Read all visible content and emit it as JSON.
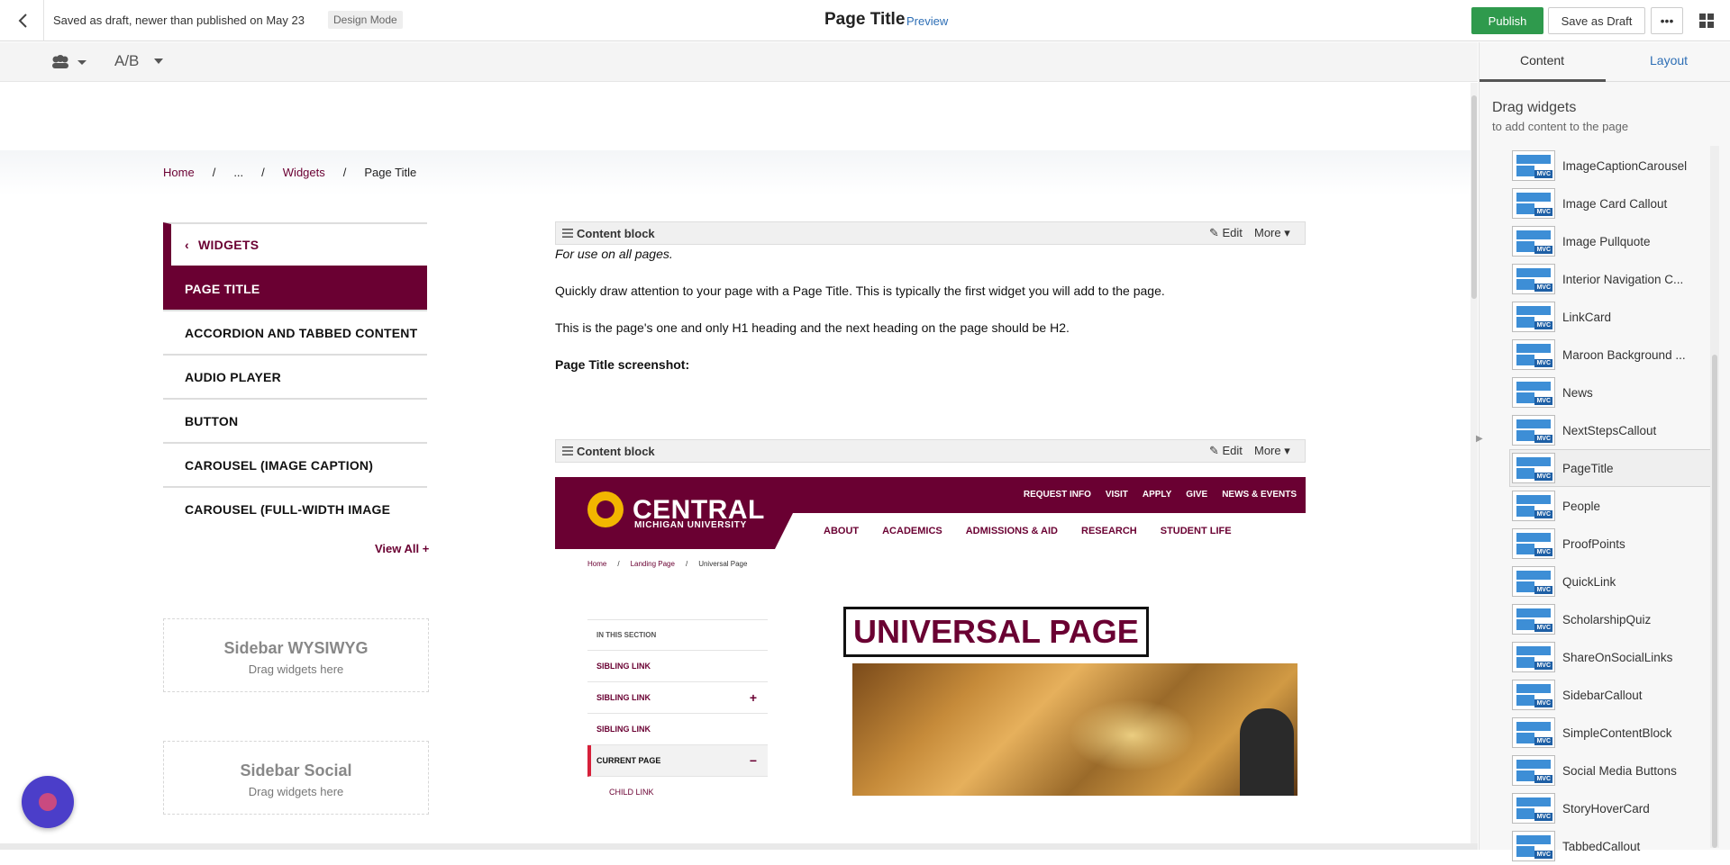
{
  "topbar": {
    "status": "Saved as draft, newer than published on May 23",
    "mode_badge": "Design Mode",
    "page_title": "Page Title",
    "preview": "Preview",
    "publish": "Publish",
    "save_draft": "Save as Draft",
    "more": "•••"
  },
  "toolbar": {
    "ab_label": "A/B"
  },
  "breadcrumb": [
    "Home",
    "...",
    "Widgets",
    "Page Title"
  ],
  "sidenav": {
    "header": "WIDGETS",
    "items": [
      "PAGE TITLE",
      "ACCORDION AND TABBED CONTENT",
      "AUDIO PLAYER",
      "BUTTON",
      "CAROUSEL (IMAGE CAPTION)",
      "CAROUSEL (FULL-WIDTH IMAGE"
    ],
    "active_index": 0,
    "view_all": "View All"
  },
  "dropzones": [
    {
      "title": "Sidebar WYSIWYG",
      "sub": "Drag widgets here"
    },
    {
      "title": "Sidebar Social",
      "sub": "Drag widgets here"
    }
  ],
  "content_block": {
    "label": "Content block",
    "edit": "Edit",
    "more": "More",
    "lines": [
      "For use on all pages.",
      "Quickly draw attention to your page with a Page Title. This is typically the first widget you will add to the page.",
      "This is the page's one and only H1 heading and the next heading on the page should be H2.",
      "Page Title screenshot:"
    ]
  },
  "screenshot": {
    "brand": "CENTRAL",
    "brand_sub": "MICHIGAN UNIVERSITY",
    "util_nav": [
      "REQUEST INFO",
      "VISIT",
      "APPLY",
      "GIVE",
      "NEWS & EVENTS"
    ],
    "main_nav": [
      "ABOUT",
      "ACADEMICS",
      "ADMISSIONS & AID",
      "RESEARCH",
      "STUDENT LIFE"
    ],
    "crumbs": [
      "Home",
      "/",
      "Landing Page",
      "/",
      "Universal Page"
    ],
    "side_header": "IN THIS SECTION",
    "side_items": [
      "SIBLING LINK",
      "SIBLING LINK",
      "SIBLING LINK",
      "CURRENT PAGE",
      "CHILD LINK"
    ],
    "hero_title": "UNIVERSAL PAGE"
  },
  "panel": {
    "tabs": [
      "Content",
      "Layout"
    ],
    "heading": "Drag widgets",
    "subheading": "to add content to the page",
    "widgets": [
      "ImageCaptionCarousel",
      "Image Card Callout",
      "Image Pullquote",
      "Interior Navigation C...",
      "LinkCard",
      "Maroon Background ...",
      "News",
      "NextStepsCallout",
      "PageTitle",
      "People",
      "ProofPoints",
      "QuickLink",
      "ScholarshipQuiz",
      "ShareOnSocialLinks",
      "SidebarCallout",
      "SimpleContentBlock",
      "Social Media Buttons",
      "StoryHoverCard",
      "TabbedCallout"
    ],
    "selected": "PageTitle",
    "badge": "MVC"
  },
  "colors": {
    "maroon": "#6a0032",
    "publish_green": "#2f9a4d",
    "link_blue": "#2d6eb5",
    "gold": "#f2b600"
  },
  "icons": {
    "back": "chevron-left-icon",
    "grid": "grid-icon",
    "persona": "users-icon",
    "chat": "chat-bubble-icon"
  }
}
